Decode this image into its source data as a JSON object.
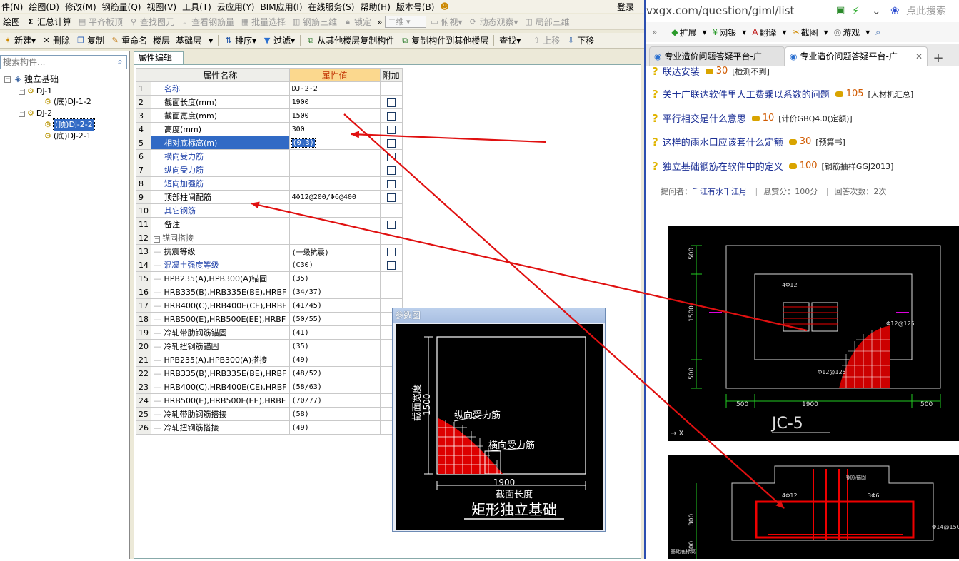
{
  "menu": [
    "件(N)",
    "绘图(D)",
    "修改(M)",
    "钢筋量(Q)",
    "视图(V)",
    "工具(T)",
    "云应用(Y)",
    "BIM应用(I)",
    "在线服务(S)",
    "帮助(H)",
    "版本号(B)"
  ],
  "login": "登录",
  "toolbar1": {
    "draw": "绘图",
    "sum": "汇总计算",
    "flat": "平齐板顶",
    "find": "查找图元",
    "view_rebar": "查看钢筋量",
    "batch": "批量选择",
    "rebar3d": "钢筋三维",
    "lock": "锁定",
    "more": "»",
    "mode": "二维",
    "top_view": "俯视",
    "dyn": "动态观察",
    "local3d": "局部三维"
  },
  "toolbar2": {
    "new": "新建",
    "delete": "删除",
    "copy": "复制",
    "rename": "重命名",
    "floor_label": "楼层",
    "floor_value": "基础层",
    "sort": "排序",
    "filter": "过滤",
    "copy_from": "从其他楼层复制构件",
    "copy_to": "复制构件到其他楼层",
    "find": "查找",
    "up": "上移",
    "down": "下移"
  },
  "tree": {
    "search_placeholder": "搜索构件...",
    "root": "独立基础",
    "dj1": "DJ-1",
    "dj1_child": "(底)DJ-1-2",
    "dj2": "DJ-2",
    "dj2_child1": "(顶)DJ-2-2",
    "dj2_child2": "(底)DJ-2-1"
  },
  "props": {
    "tab": "属性编辑",
    "h_name": "属性名称",
    "h_value": "属性值",
    "h_add": "附加",
    "rows": [
      {
        "n": "1",
        "name": "名称",
        "value": "DJ-2-2",
        "blue": true,
        "cb": false
      },
      {
        "n": "2",
        "name": "截面长度(mm)",
        "value": "1900",
        "blue": false,
        "cb": true
      },
      {
        "n": "3",
        "name": "截面宽度(mm)",
        "value": "1500",
        "blue": false,
        "cb": true
      },
      {
        "n": "4",
        "name": "高度(mm)",
        "value": "300",
        "blue": false,
        "cb": true
      },
      {
        "n": "5",
        "name": "相对底标高(m)",
        "value": "(0.3)",
        "blue": true,
        "cb": true,
        "hl": true
      },
      {
        "n": "6",
        "name": "横向受力筋",
        "value": "",
        "blue": true,
        "cb": true
      },
      {
        "n": "7",
        "name": "纵向受力筋",
        "value": "",
        "blue": true,
        "cb": true
      },
      {
        "n": "8",
        "name": "短向加强筋",
        "value": "",
        "blue": true,
        "cb": true
      },
      {
        "n": "9",
        "name": "顶部柱间配筋",
        "value": "4Φ12@200/Φ6@400",
        "blue": false,
        "cb": true
      },
      {
        "n": "10",
        "name": "其它钢筋",
        "value": "",
        "blue": true,
        "cb": false
      },
      {
        "n": "11",
        "name": "备注",
        "value": "",
        "blue": false,
        "cb": true
      },
      {
        "n": "12",
        "name": "锚固搭接",
        "value": "",
        "group": true
      },
      {
        "n": "13",
        "name": "抗震等级",
        "value": "(一级抗震)",
        "blue": false,
        "cb": true,
        "indent": true
      },
      {
        "n": "14",
        "name": "混凝土强度等级",
        "value": "(C30)",
        "blue": true,
        "cb": true,
        "indent": true
      },
      {
        "n": "15",
        "name": "HPB235(A),HPB300(A)锚固",
        "value": "(35)",
        "blue": false,
        "cb": false,
        "indent": true
      },
      {
        "n": "16",
        "name": "HRB335(B),HRB335E(BE),HRBF",
        "value": "(34/37)",
        "blue": false,
        "cb": false,
        "indent": true
      },
      {
        "n": "17",
        "name": "HRB400(C),HRB400E(CE),HRBF",
        "value": "(41/45)",
        "blue": false,
        "cb": false,
        "indent": true
      },
      {
        "n": "18",
        "name": "HRB500(E),HRB500E(EE),HRBF",
        "value": "(50/55)",
        "blue": false,
        "cb": false,
        "indent": true
      },
      {
        "n": "19",
        "name": "冷轧带肋钢筋锚固",
        "value": "(41)",
        "blue": false,
        "cb": false,
        "indent": true
      },
      {
        "n": "20",
        "name": "冷轧扭钢筋锚固",
        "value": "(35)",
        "blue": false,
        "cb": false,
        "indent": true
      },
      {
        "n": "21",
        "name": "HPB235(A),HPB300(A)搭接",
        "value": "(49)",
        "blue": false,
        "cb": false,
        "indent": true
      },
      {
        "n": "22",
        "name": "HRB335(B),HRB335E(BE),HRBF",
        "value": "(48/52)",
        "blue": false,
        "cb": false,
        "indent": true
      },
      {
        "n": "23",
        "name": "HRB400(C),HRB400E(CE),HRBF",
        "value": "(58/63)",
        "blue": false,
        "cb": false,
        "indent": true
      },
      {
        "n": "24",
        "name": "HRB500(E),HRB500E(EE),HRBF",
        "value": "(70/77)",
        "blue": false,
        "cb": false,
        "indent": true
      },
      {
        "n": "25",
        "name": "冷轧带肋钢筋搭接",
        "value": "(58)",
        "blue": false,
        "cb": false,
        "indent": true
      },
      {
        "n": "26",
        "name": "冷轧扭钢筋搭接",
        "value": "(49)",
        "blue": false,
        "cb": false,
        "indent": true
      }
    ]
  },
  "param": {
    "title": "参数图",
    "width_label": "截面宽度",
    "width_val": "1500",
    "long_bar": "纵向受力筋",
    "trans_bar": "横向受力筋",
    "len_val": "1900",
    "len_label": "截面长度",
    "caption": "矩形独立基础"
  },
  "browser": {
    "address": "vxgx.com/question/giml/list",
    "search_hint": "点此搜索",
    "toolbar": [
      "扩展",
      "网银",
      "翻译",
      "截图",
      "游戏"
    ],
    "tab1": "专业造价问题答疑平台-广",
    "tab2": "专业造价问题答疑平台-广",
    "questions": [
      {
        "title": "联达安装",
        "points": "30",
        "tag": "[检测不到]"
      },
      {
        "title": "关于广联达软件里人工费乘以系数的问题",
        "points": "105",
        "tag": "[人材机汇总]"
      },
      {
        "title": "平行相交是什么意思",
        "points": "10",
        "tag": "[计价GBQ4.0(定额)]"
      },
      {
        "title": "这样的雨水口应该套什么定额",
        "points": "30",
        "tag": "[预算书]"
      },
      {
        "title": "独立基础钢筋在软件中的定义",
        "points": "100",
        "tag": "[钢筋抽样GGJ2013]"
      }
    ],
    "meta": {
      "asker_label": "提问者：",
      "asker": "千江有水千江月",
      "reward": "悬赏分：100分",
      "answers": "回答次数：2次"
    },
    "cad1": {
      "dim_500a": "500",
      "dim_1500": "1500",
      "dim_500b": "500",
      "dim_1900": "1900",
      "rebar_a": "4Φ12",
      "rebar_b": "Φ12@125",
      "rebar_c": "Φ12@125",
      "title": "JC-5"
    },
    "cad2": {
      "rebar_a": "4Φ12",
      "rebar_b": "3Φ6",
      "rebar_c": "Φ14@150",
      "dim_300a": "300",
      "dim_300b": "300",
      "note": "钢筋锚固",
      "bottom": "基础底标高"
    }
  },
  "colors": {
    "accent": "#316ac5",
    "arrow": "#e01010",
    "header_value": "#fbd88e"
  }
}
